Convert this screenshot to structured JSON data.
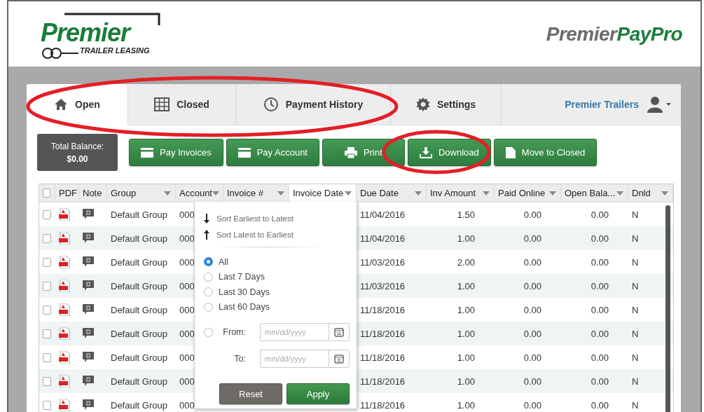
{
  "header": {
    "company_logo": {
      "name": "Premier",
      "tagline": "TRAILER LEASING"
    },
    "product_logo": {
      "first": "Premier",
      "second": "PayPro"
    }
  },
  "tabs": [
    {
      "label": "Open",
      "selected": true
    },
    {
      "label": "Closed",
      "selected": false
    },
    {
      "label": "Payment History",
      "selected": false
    },
    {
      "label": "Settings",
      "selected": false
    }
  ],
  "user_menu": {
    "name": "Premier Trailers"
  },
  "total_balance": {
    "label": "Total Balance:",
    "value": "$0.00"
  },
  "actions": [
    {
      "label": "Pay Invoices"
    },
    {
      "label": "Pay Account"
    },
    {
      "label": "Print"
    },
    {
      "label": "Download"
    },
    {
      "label": "Move to Closed"
    }
  ],
  "table": {
    "columns": [
      {
        "kind": "checkbox",
        "checked": false
      },
      {
        "kind": "plain",
        "label": "PDF",
        "active": false
      },
      {
        "kind": "plain",
        "label": "Note",
        "active": false
      },
      {
        "kind": "menu",
        "label": "Group",
        "active": false
      },
      {
        "kind": "menu",
        "label": "Account",
        "active": false
      },
      {
        "kind": "menu",
        "label": "Invoice #",
        "active": false
      },
      {
        "kind": "menu",
        "label": "Invoice Date",
        "active": true
      },
      {
        "kind": "menu",
        "label": "Due Date",
        "active": false
      },
      {
        "kind": "menu",
        "label": "Inv Amount",
        "active": false
      },
      {
        "kind": "menu",
        "label": "Paid Online",
        "active": false
      },
      {
        "kind": "menu",
        "label": "Open Bala...",
        "active": false
      },
      {
        "kind": "menu",
        "label": "Dnld",
        "active": false
      }
    ],
    "rows": [
      {
        "checked": false,
        "group": "Default Group",
        "account": "000",
        "due_date": "11/04/2016",
        "inv_amount": "1.50",
        "paid_online": "0.00",
        "open_balance": "0.00",
        "dnld": "N"
      },
      {
        "checked": false,
        "group": "Default Group",
        "account": "000",
        "due_date": "11/04/2016",
        "inv_amount": "1.00",
        "paid_online": "0.00",
        "open_balance": "0.00",
        "dnld": "N"
      },
      {
        "checked": false,
        "group": "Default Group",
        "account": "000",
        "due_date": "11/03/2016",
        "inv_amount": "2.00",
        "paid_online": "0.00",
        "open_balance": "0.00",
        "dnld": "N"
      },
      {
        "checked": false,
        "group": "Default Group",
        "account": "000",
        "due_date": "11/03/2016",
        "inv_amount": "1.00",
        "paid_online": "0.00",
        "open_balance": "0.00",
        "dnld": "N"
      },
      {
        "checked": false,
        "group": "Default Group",
        "account": "000",
        "due_date": "11/18/2016",
        "inv_amount": "1.00",
        "paid_online": "0.00",
        "open_balance": "0.00",
        "dnld": "N"
      },
      {
        "checked": false,
        "group": "Default Group",
        "account": "000",
        "due_date": "11/18/2016",
        "inv_amount": "1.00",
        "paid_online": "0.00",
        "open_balance": "0.00",
        "dnld": "N"
      },
      {
        "checked": false,
        "group": "Default Group",
        "account": "000",
        "due_date": "11/18/2016",
        "inv_amount": "1.00",
        "paid_online": "0.00",
        "open_balance": "0.00",
        "dnld": "N"
      },
      {
        "checked": false,
        "group": "Default Group",
        "account": "000",
        "due_date": "11/18/2016",
        "inv_amount": "1.00",
        "paid_online": "0.00",
        "open_balance": "0.00",
        "dnld": "N"
      },
      {
        "checked": false,
        "group": "Default Group",
        "account": "000",
        "due_date": "11/18/2016",
        "inv_amount": "1.00",
        "paid_online": "0.00",
        "open_balance": "0.00",
        "dnld": "N"
      }
    ]
  },
  "filter_menu": {
    "sort_options": [
      {
        "label": "Sort Earliest to Latest"
      },
      {
        "label": "Sort Latest to Earliest"
      }
    ],
    "ranges": [
      {
        "label": "All",
        "selected": true
      },
      {
        "label": "Last 7 Days",
        "selected": false
      },
      {
        "label": "Last 30 Days",
        "selected": false
      },
      {
        "label": "Last 60 Days",
        "selected": false
      }
    ],
    "from": {
      "label": "From:",
      "placeholder": "mm/dd/yyyy",
      "selected": false
    },
    "to": {
      "label": "To:",
      "placeholder": "mm/dd/yyyy"
    },
    "buttons": [
      {
        "label": "Reset",
        "kind": "secondary"
      },
      {
        "label": "Apply",
        "kind": "primary"
      }
    ]
  },
  "annotations": [
    {
      "kind": "ellipse"
    },
    {
      "kind": "ellipse"
    }
  ]
}
